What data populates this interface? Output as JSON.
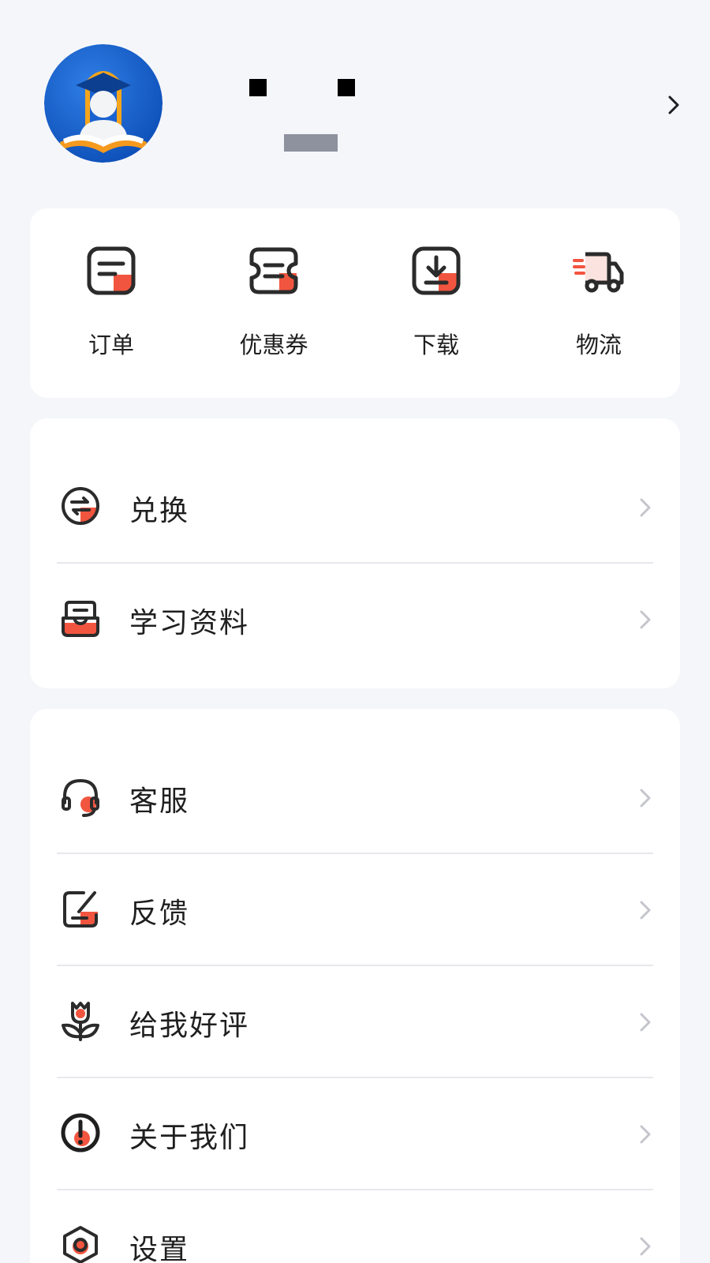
{
  "profile": {
    "avatar_icon": "graduate-book-avatar",
    "chevron_icon": "chevron-right-icon"
  },
  "quick_actions": [
    {
      "label": "订单",
      "icon": "order-icon"
    },
    {
      "label": "优惠券",
      "icon": "coupon-icon"
    },
    {
      "label": "下载",
      "icon": "download-icon"
    },
    {
      "label": "物流",
      "icon": "truck-icon"
    }
  ],
  "menu_group_1": [
    {
      "label": "兑换",
      "icon": "exchange-icon"
    },
    {
      "label": "学习资料",
      "icon": "inbox-icon"
    }
  ],
  "menu_group_2": [
    {
      "label": "客服",
      "icon": "headset-icon"
    },
    {
      "label": "反馈",
      "icon": "feedback-edit-icon"
    },
    {
      "label": "给我好评",
      "icon": "flower-icon"
    },
    {
      "label": "关于我们",
      "icon": "info-alert-icon"
    },
    {
      "label": "设置",
      "icon": "settings-hexagon-icon"
    }
  ],
  "colors": {
    "accent": "#f2553f",
    "icon_stroke": "#2b2b2b",
    "background": "#f5f6fa",
    "card": "#ffffff"
  }
}
